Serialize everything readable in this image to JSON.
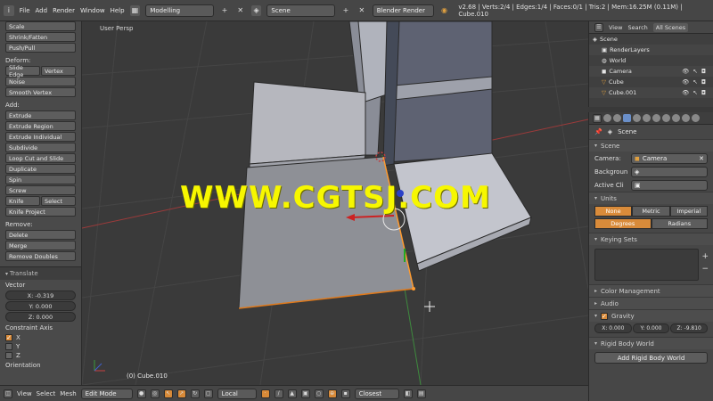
{
  "topbar": {
    "menus": [
      "File",
      "Add",
      "Render",
      "Window",
      "Help"
    ],
    "screen_layout": "Modelling",
    "scene": "Scene",
    "render_engine": "Blender Render",
    "stats": "v2.68 | Verts:2/4 | Edges:1/4 | Faces:0/1 | Tris:2 | Mem:16.25M (0.11M) | Cube.010"
  },
  "left_panel": {
    "top_buttons": [
      "Scale",
      "Shrink/Fatten",
      "Push/Pull"
    ],
    "deform_head": "Deform:",
    "deform_row": [
      "Slide Edge",
      "Vertex"
    ],
    "deform_buttons": [
      "Noise",
      "Smooth Vertex"
    ],
    "add_head": "Add:",
    "add_buttons": [
      "Extrude",
      "Extrude Region",
      "Extrude Individual",
      "Subdivide",
      "Loop Cut and Slide",
      "Duplicate",
      "Spin",
      "Screw"
    ],
    "knife_row": [
      "Knife",
      "Select"
    ],
    "knife_project": "Knife Project",
    "remove_head": "Remove:",
    "remove_buttons": [
      "Delete",
      "Merge",
      "Remove Doubles"
    ],
    "operator_title": "Translate",
    "vector_head": "Vector",
    "vector": [
      "X: -0.319",
      "Y: 0.000",
      "Z: 0.000"
    ],
    "constraint_head": "Constraint Axis",
    "axes": [
      {
        "label": "X",
        "checked": true
      },
      {
        "label": "Y",
        "checked": false
      },
      {
        "label": "Z",
        "checked": false
      }
    ],
    "orientation_head": "Orientation"
  },
  "viewport": {
    "view_label": "User Persp",
    "object_label": "(0) Cube.010",
    "watermark": "WWW.CGTSJ.COM"
  },
  "bottombar": {
    "menus": [
      "View",
      "Select",
      "Mesh"
    ],
    "mode": "Edit Mode",
    "orientation": "Local",
    "snap": "Closest"
  },
  "outliner": {
    "view": "View",
    "search": "Search",
    "filter": "All Scenes",
    "items": [
      {
        "label": "Scene",
        "icon": "scene-icon"
      },
      {
        "label": "RenderLayers",
        "icon": "renderlayers-icon"
      },
      {
        "label": "World",
        "icon": "world-icon"
      },
      {
        "label": "Camera",
        "icon": "camera-icon"
      },
      {
        "label": "Cube",
        "icon": "mesh-icon"
      },
      {
        "label": "Cube.001",
        "icon": "mesh-icon"
      }
    ]
  },
  "properties": {
    "crumb": "Scene",
    "scene_panel": "Scene",
    "camera_label": "Camera:",
    "camera_value": "Camera",
    "background_label": "Backgroun",
    "active_clip_label": "Active Cli",
    "units_panel": "Units",
    "unit_systems": [
      "None",
      "Metric",
      "Imperial"
    ],
    "rotation_units": [
      "Degrees",
      "Radians"
    ],
    "keying_panel": "Keying Sets",
    "color_mgmt": "Color Management",
    "audio": "Audio",
    "gravity": "Gravity",
    "gravity_values": [
      "X: 0.000",
      "Y: 0.000",
      "Z: -9.810"
    ],
    "rigid_body": "Rigid Body World",
    "rigid_body_btn": "Add Rigid Body World"
  },
  "colors": {
    "accent": "#d98b3a",
    "watermark": "#f7f700",
    "panel": "#474747"
  }
}
